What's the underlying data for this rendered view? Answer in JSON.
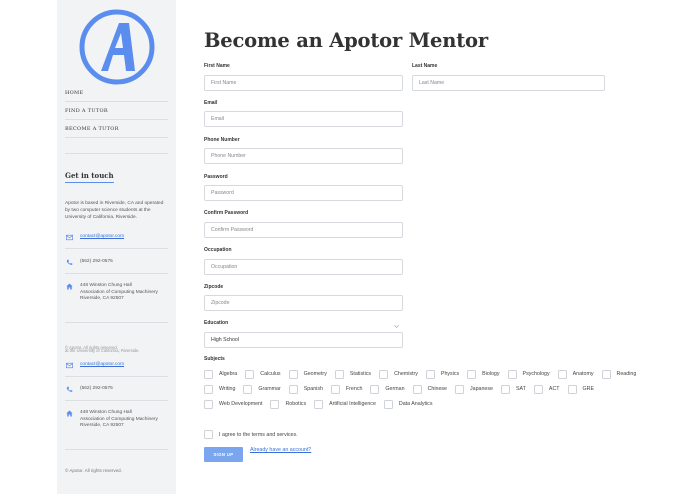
{
  "colors": {
    "accent": "#5b8def",
    "sidebar_bg": "#f2f3f5",
    "button_bg": "#7aa6f0",
    "link": "#3a6fd8"
  },
  "brand": {
    "logo_letter": "A"
  },
  "sidebar": {
    "nav": [
      {
        "label": "HOME"
      },
      {
        "label": "FIND A TUTOR"
      },
      {
        "label": "BECOME A TUTOR"
      }
    ],
    "get_in_touch": "Get in touch",
    "about": "Apotor is based in Riverside, CA and operated by two computer science students at the University of California, Riverside.",
    "about_ghost": "at the University of California, Riverside.",
    "contact": [
      {
        "icon": "envelope-icon",
        "text": "contact@apotor.com"
      },
      {
        "icon": "phone-icon",
        "text": "(562) 292-0575"
      },
      {
        "icon": "home-icon",
        "lines": [
          "448 Winston Chung Hall",
          "Association of Computing Machinery",
          "Riverside, CA 92507"
        ]
      }
    ],
    "copyright": "© Apotor. All rights reserved."
  },
  "form": {
    "title": "Become an Apotor Mentor",
    "first_name": {
      "label": "First Name",
      "placeholder": "First Name"
    },
    "last_name": {
      "label": "Last Name",
      "placeholder": "Last Name"
    },
    "email": {
      "label": "Email",
      "placeholder": "Email"
    },
    "phone": {
      "label": "Phone Number",
      "placeholder": "Phone Number"
    },
    "password": {
      "label": "Password",
      "placeholder": "Password"
    },
    "confirm_password": {
      "label": "Confirm Password",
      "placeholder": "Confirm Password"
    },
    "occupation": {
      "label": "Occupation",
      "placeholder": "Occupation"
    },
    "zipcode": {
      "label": "Zipcode",
      "placeholder": "Zipcode"
    },
    "education": {
      "label": "Education",
      "value": "High School"
    },
    "subjects_label": "Subjects",
    "subjects": [
      [
        "Algebra",
        "Calculus",
        "Geometry",
        "Statistics",
        "Chemistry",
        "Physics",
        "Biology",
        "Psychology",
        "Anatomy",
        "Reading"
      ],
      [
        "Writing",
        "Grammar",
        "Spanish",
        "French",
        "German",
        "Chinese",
        "Japanese",
        "SAT",
        "ACT",
        "GRE"
      ],
      [
        "Web Development",
        "Robotics",
        "Artificial Intelligence",
        "Data Analytics"
      ]
    ],
    "terms": "I agree to the terms and services.",
    "signup": "SIGN UP",
    "have_account": "Already have an account?"
  }
}
